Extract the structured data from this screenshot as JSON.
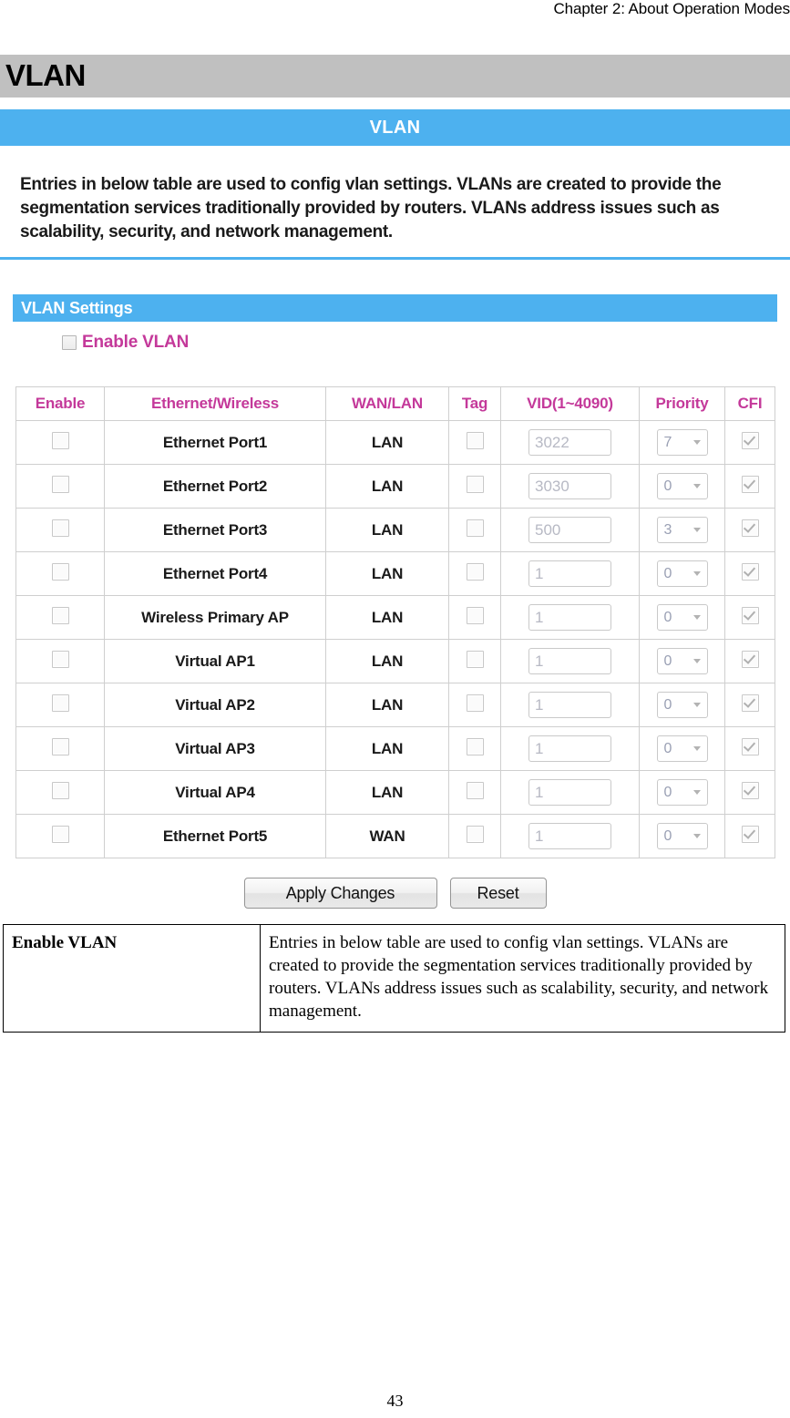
{
  "document": {
    "running_header": "Chapter 2: About Operation Modes",
    "page_number": "43",
    "section_title": "VLAN"
  },
  "panel": {
    "title_bar": "VLAN",
    "intro_text": "Entries in below table are used to config vlan settings. VLANs are created to provide the segmentation services traditionally provided by routers. VLANs address issues such as scalability, security, and network management.",
    "settings_bar": "VLAN Settings",
    "enable_vlan_label": "Enable VLAN",
    "enable_vlan_checked": false
  },
  "table": {
    "headers": {
      "enable": "Enable",
      "ethernet_wireless": "Ethernet/Wireless",
      "wan_lan": "WAN/LAN",
      "tag": "Tag",
      "vid": "VID(1~4090)",
      "priority": "Priority",
      "cfi": "CFI"
    },
    "rows": [
      {
        "enable": false,
        "name": "Ethernet Port1",
        "wan_lan": "LAN",
        "tag": false,
        "vid": "3022",
        "priority": "7",
        "cfi": true
      },
      {
        "enable": false,
        "name": "Ethernet Port2",
        "wan_lan": "LAN",
        "tag": false,
        "vid": "3030",
        "priority": "0",
        "cfi": true
      },
      {
        "enable": false,
        "name": "Ethernet Port3",
        "wan_lan": "LAN",
        "tag": false,
        "vid": "500",
        "priority": "3",
        "cfi": true
      },
      {
        "enable": false,
        "name": "Ethernet Port4",
        "wan_lan": "LAN",
        "tag": false,
        "vid": "1",
        "priority": "0",
        "cfi": true
      },
      {
        "enable": false,
        "name": "Wireless Primary AP",
        "wan_lan": "LAN",
        "tag": false,
        "vid": "1",
        "priority": "0",
        "cfi": true
      },
      {
        "enable": false,
        "name": "Virtual AP1",
        "wan_lan": "LAN",
        "tag": false,
        "vid": "1",
        "priority": "0",
        "cfi": true
      },
      {
        "enable": false,
        "name": "Virtual AP2",
        "wan_lan": "LAN",
        "tag": false,
        "vid": "1",
        "priority": "0",
        "cfi": true
      },
      {
        "enable": false,
        "name": "Virtual AP3",
        "wan_lan": "LAN",
        "tag": false,
        "vid": "1",
        "priority": "0",
        "cfi": true
      },
      {
        "enable": false,
        "name": "Virtual AP4",
        "wan_lan": "LAN",
        "tag": false,
        "vid": "1",
        "priority": "0",
        "cfi": true
      },
      {
        "enable": false,
        "name": "Ethernet Port5",
        "wan_lan": "WAN",
        "tag": false,
        "vid": "1",
        "priority": "0",
        "cfi": true
      }
    ]
  },
  "buttons": {
    "apply": "Apply Changes",
    "reset": "Reset"
  },
  "description_table": {
    "key": "Enable VLAN",
    "value": "Entries in below table are used to config vlan settings. VLANs are created to provide the segmentation services traditionally provided by routers. VLANs address issues such as scalability, security, and network management."
  },
  "colors": {
    "blue": "#4db1ef",
    "gray_band": "#c0c0c0",
    "header_magenta": "#c4399a",
    "disabled_text": "#b7b9c4"
  }
}
